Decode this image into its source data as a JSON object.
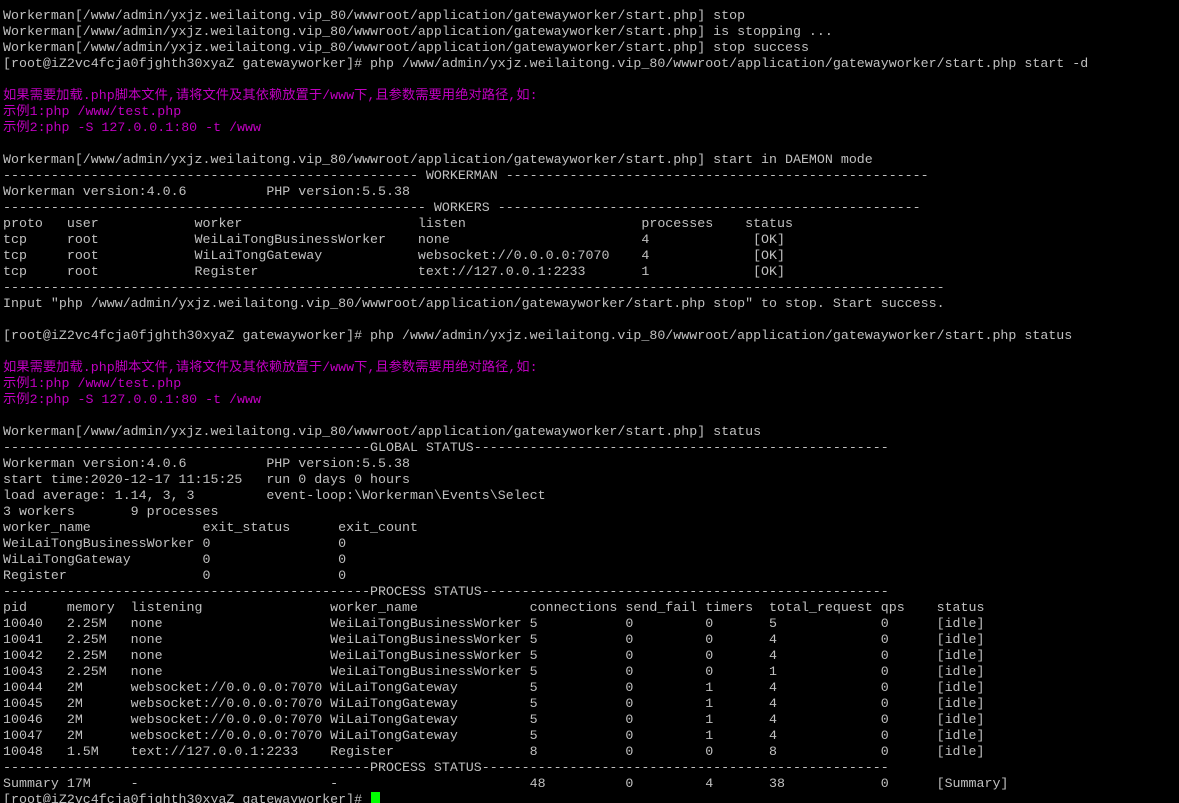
{
  "terminal": {
    "colors": {
      "background": "#000000",
      "text": "#c0c0c0",
      "highlight": "#c000c0",
      "cursor": "#00ff00"
    },
    "lines": [
      {
        "text": "Workerman[/www/admin/yxjz.weilaitong.vip_80/wwwroot/application/gatewayworker/start.php] stop",
        "style": "normal"
      },
      {
        "text": "Workerman[/www/admin/yxjz.weilaitong.vip_80/wwwroot/application/gatewayworker/start.php] is stopping ...",
        "style": "normal"
      },
      {
        "text": "Workerman[/www/admin/yxjz.weilaitong.vip_80/wwwroot/application/gatewayworker/start.php] stop success",
        "style": "normal"
      },
      {
        "text": "[root@iZ2vc4fcja0fjghth30xyaZ gatewayworker]# php /www/admin/yxjz.weilaitong.vip_80/wwwroot/application/gatewayworker/start.php start -d",
        "style": "normal"
      },
      {
        "text": "",
        "style": "normal"
      },
      {
        "text": "如果需要加载.php脚本文件,请将文件及其依赖放置于/www下,且参数需要用绝对路径,如:",
        "style": "magenta"
      },
      {
        "text": "示例1:php /www/test.php",
        "style": "magenta"
      },
      {
        "text": "示例2:php -S 127.0.0.1:80 -t /www",
        "style": "magenta"
      },
      {
        "text": "",
        "style": "normal"
      },
      {
        "text": "Workerman[/www/admin/yxjz.weilaitong.vip_80/wwwroot/application/gatewayworker/start.php] start in DAEMON mode",
        "style": "normal"
      },
      {
        "text": "---------------------------------------------------- WORKERMAN -----------------------------------------------------",
        "style": "normal"
      },
      {
        "text": "Workerman version:4.0.6          PHP version:5.5.38",
        "style": "normal"
      },
      {
        "text": "----------------------------------------------------- WORKERS -----------------------------------------------------",
        "style": "normal"
      },
      {
        "text": "proto   user            worker                      listen                      processes    status",
        "style": "normal"
      },
      {
        "text": "tcp     root            WeiLaiTongBusinessWorker    none                        4             [OK]",
        "style": "normal"
      },
      {
        "text": "tcp     root            WiLaiTongGateway            websocket://0.0.0.0:7070    4             [OK]",
        "style": "normal"
      },
      {
        "text": "tcp     root            Register                    text://127.0.0.1:2233       1             [OK]",
        "style": "normal"
      },
      {
        "text": "----------------------------------------------------------------------------------------------------------------------",
        "style": "normal"
      },
      {
        "text": "Input \"php /www/admin/yxjz.weilaitong.vip_80/wwwroot/application/gatewayworker/start.php stop\" to stop. Start success.",
        "style": "normal"
      },
      {
        "text": "",
        "style": "normal"
      },
      {
        "text": "[root@iZ2vc4fcja0fjghth30xyaZ gatewayworker]# php /www/admin/yxjz.weilaitong.vip_80/wwwroot/application/gatewayworker/start.php status",
        "style": "normal"
      },
      {
        "text": "",
        "style": "normal"
      },
      {
        "text": "如果需要加载.php脚本文件,请将文件及其依赖放置于/www下,且参数需要用绝对路径,如:",
        "style": "magenta"
      },
      {
        "text": "示例1:php /www/test.php",
        "style": "magenta"
      },
      {
        "text": "示例2:php -S 127.0.0.1:80 -t /www",
        "style": "magenta"
      },
      {
        "text": "",
        "style": "normal"
      },
      {
        "text": "Workerman[/www/admin/yxjz.weilaitong.vip_80/wwwroot/application/gatewayworker/start.php] status",
        "style": "normal"
      },
      {
        "text": "----------------------------------------------GLOBAL STATUS----------------------------------------------------",
        "style": "normal"
      },
      {
        "text": "Workerman version:4.0.6          PHP version:5.5.38",
        "style": "normal"
      },
      {
        "text": "start time:2020-12-17 11:15:25   run 0 days 0 hours",
        "style": "normal"
      },
      {
        "text": "load average: 1.14, 3, 3         event-loop:\\Workerman\\Events\\Select",
        "style": "normal"
      },
      {
        "text": "3 workers       9 processes",
        "style": "normal"
      },
      {
        "text": "worker_name              exit_status      exit_count",
        "style": "normal"
      },
      {
        "text": "WeiLaiTongBusinessWorker 0                0",
        "style": "normal"
      },
      {
        "text": "WiLaiTongGateway         0                0",
        "style": "normal"
      },
      {
        "text": "Register                 0                0",
        "style": "normal"
      },
      {
        "text": "----------------------------------------------PROCESS STATUS---------------------------------------------------",
        "style": "normal"
      },
      {
        "text": "pid     memory  listening                worker_name              connections send_fail timers  total_request qps    status",
        "style": "normal"
      },
      {
        "text": "10040   2.25M   none                     WeiLaiTongBusinessWorker 5           0         0       5             0      [idle]",
        "style": "normal"
      },
      {
        "text": "10041   2.25M   none                     WeiLaiTongBusinessWorker 5           0         0       4             0      [idle]",
        "style": "normal"
      },
      {
        "text": "10042   2.25M   none                     WeiLaiTongBusinessWorker 5           0         0       4             0      [idle]",
        "style": "normal"
      },
      {
        "text": "10043   2.25M   none                     WeiLaiTongBusinessWorker 5           0         0       1             0      [idle]",
        "style": "normal"
      },
      {
        "text": "10044   2M      websocket://0.0.0.0:7070 WiLaiTongGateway         5           0         1       4             0      [idle]",
        "style": "normal"
      },
      {
        "text": "10045   2M      websocket://0.0.0.0:7070 WiLaiTongGateway         5           0         1       4             0      [idle]",
        "style": "normal"
      },
      {
        "text": "10046   2M      websocket://0.0.0.0:7070 WiLaiTongGateway         5           0         1       4             0      [idle]",
        "style": "normal"
      },
      {
        "text": "10047   2M      websocket://0.0.0.0:7070 WiLaiTongGateway         5           0         1       4             0      [idle]",
        "style": "normal"
      },
      {
        "text": "10048   1.5M    text://127.0.0.1:2233    Register                 8           0         0       8             0      [idle]",
        "style": "normal"
      },
      {
        "text": "----------------------------------------------PROCESS STATUS---------------------------------------------------",
        "style": "normal"
      },
      {
        "text": "Summary 17M     -                        -                        48          0         4       38            0      [Summary]",
        "style": "normal"
      },
      {
        "text": "[root@iZ2vc4fcja0fjghth30xyaZ gatewayworker]# ",
        "style": "normal",
        "cursor": true
      }
    ]
  }
}
